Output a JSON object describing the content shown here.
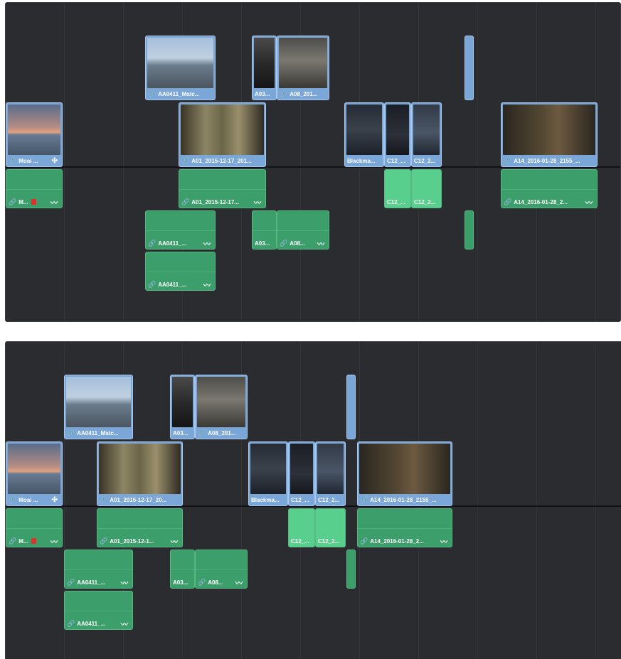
{
  "timeline_top": {
    "video_clips": {
      "moai": "Moai ...",
      "aa0411": "AA0411_Matc...",
      "a03": "A03...",
      "a08": "A08_201...",
      "a01": "A01_2015-12-17_201...",
      "blackma": "Blackma...",
      "c12a": "C12_...",
      "c12b": "C12_2...",
      "a14": "A14_2016-01-28_2155_..."
    },
    "audio_clips": {
      "moai": "M...",
      "a01": "A01_2015-12-17...",
      "c12a": "C12_...",
      "c12b": "C12_2...",
      "a14": "A14_2016-01-28_2...",
      "aa0411_1": "AA0411_...",
      "a03": "A03...",
      "a08": "A08...",
      "aa0411_2": "AA0411_..."
    }
  },
  "timeline_bottom": {
    "video_clips": {
      "moai": "Moai ...",
      "aa0411": "AA0411_Matc...",
      "a03": "A03...",
      "a08": "A08_201...",
      "a01": "A01_2015-12-17_20...",
      "blackma": "Blackma...",
      "c12a": "C12_...",
      "c12b": "C12_2...",
      "a14": "A14_2016-01-28_2155_..."
    },
    "audio_clips": {
      "moai": "M...",
      "a01": "A01_2015-12-1...",
      "c12a": "C12_...",
      "c12b": "C12_2...",
      "a14": "A14_2016-01-28_2...",
      "aa0411_1": "AA0411_...",
      "a03": "A03...",
      "a08": "A08...",
      "aa0411_2": "AA0411_..."
    }
  },
  "icons": {
    "link": "🔗",
    "curve": "〰",
    "multicam": "✣"
  },
  "colors": {
    "video_clip": "#7aa6d8",
    "audio_clip": "#3c9e6b",
    "flag": "#e0322b",
    "background": "#2b2c30"
  }
}
